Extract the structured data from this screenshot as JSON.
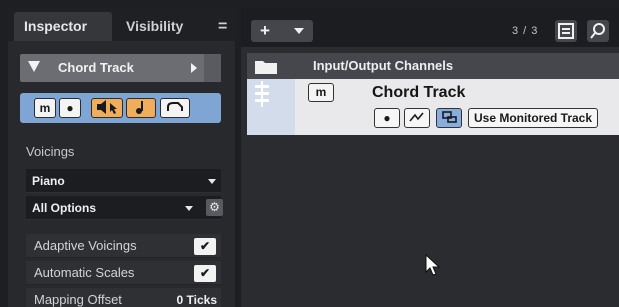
{
  "inspector": {
    "tabs": [
      "Inspector",
      "Visibility"
    ],
    "menu_glyph": "=",
    "track_name": "Chord Track",
    "buttons": {
      "mute": "m",
      "record": "●"
    },
    "voicings_label": "Voicings",
    "voicing_value": "Piano",
    "options_value": "All Options",
    "checkboxes": [
      {
        "label": "Adaptive Voicings",
        "checked": true
      },
      {
        "label": "Automatic Scales",
        "checked": true
      }
    ],
    "mapping_offset": {
      "label": "Mapping Offset",
      "value": "0 Ticks"
    },
    "colors": {
      "accent": "#7ea5d4",
      "orange": "#f0ad5c"
    }
  },
  "project": {
    "add_label": "+",
    "track_count": "3 / 3",
    "folder_title": "Input/Output Channels",
    "chord_track": {
      "title": "Chord Track",
      "mute": "m",
      "record": "●",
      "monitored_label": "Use Monitored Track"
    }
  }
}
